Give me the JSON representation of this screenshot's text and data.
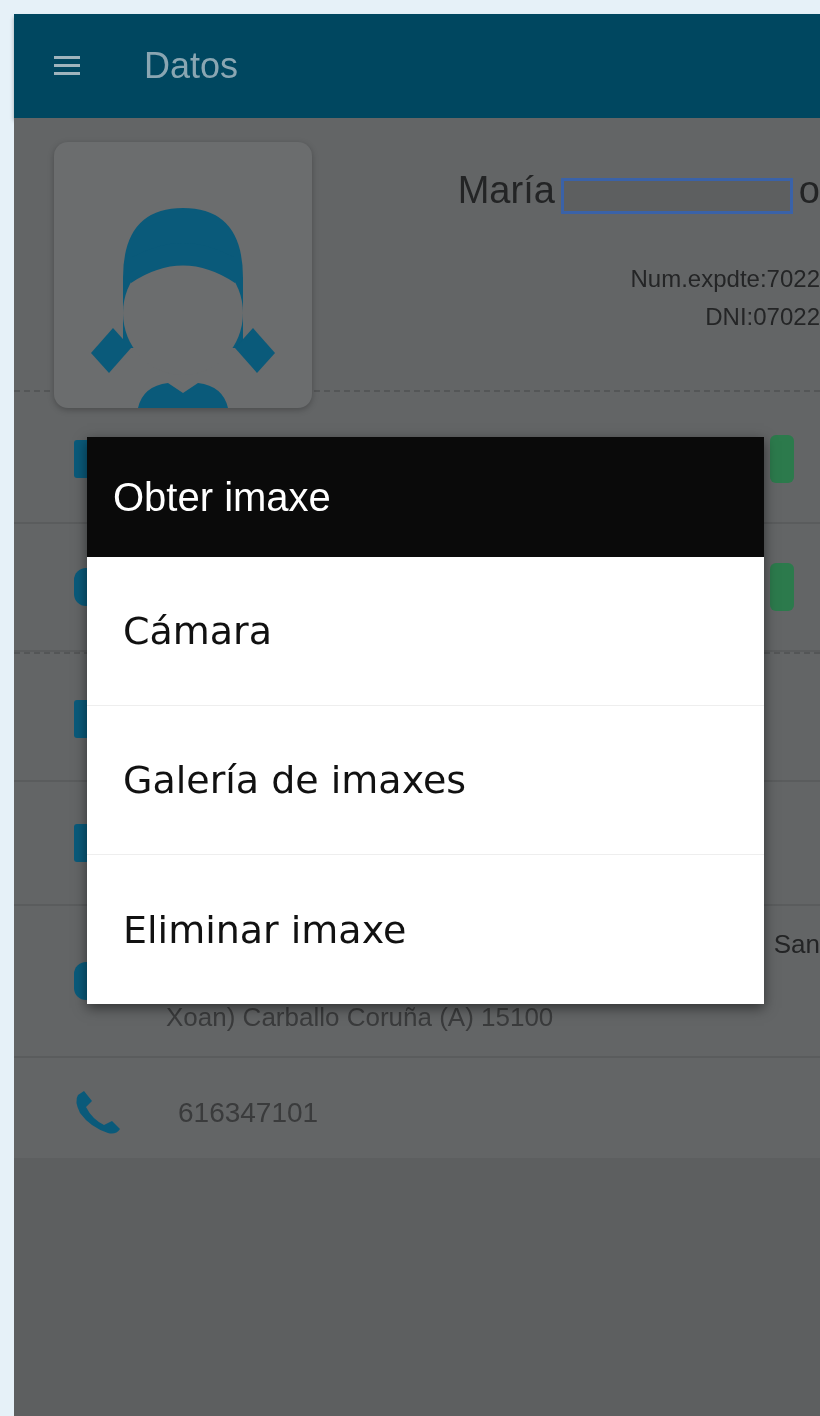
{
  "app_bar": {
    "title": "Datos"
  },
  "profile": {
    "name_start": "María",
    "name_end": "o",
    "expediente": "Num.expdte:7022",
    "dni": "DNI:07022"
  },
  "address": {
    "line_end": "San",
    "line_2": "Xoan) Carballo Coruña (A) 15100"
  },
  "phone": "616347101",
  "dialog": {
    "title": "Obter imaxe",
    "options": [
      "Cámara",
      "Galería de imaxes",
      "Eliminar imaxe"
    ]
  }
}
